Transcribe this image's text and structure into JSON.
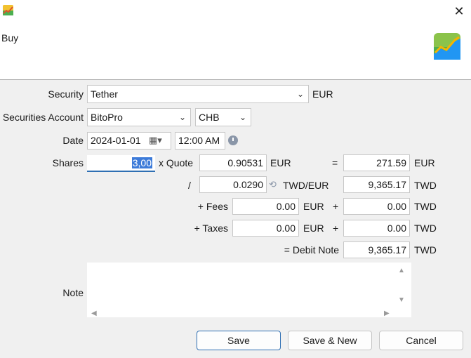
{
  "window": {
    "title": "Buy"
  },
  "form": {
    "security_label": "Security",
    "security_value": "Tether",
    "security_currency": "EUR",
    "account_label": "Securities Account",
    "account_value": "BitoPro",
    "account_currency_value": "CHB",
    "date_label": "Date",
    "date_value": "2024-01-01",
    "time_value": "12:00 AM",
    "shares_label": "Shares",
    "shares_value": "3,00",
    "quote_label": "x Quote",
    "quote_value": "0.90531",
    "quote_currency": "EUR",
    "equals": "=",
    "gross_value": "271.59",
    "gross_currency": "EUR",
    "divide": "/",
    "exchange_rate": "0.0290",
    "exchange_pair": "TWD/EUR",
    "converted_value": "9,365.17",
    "converted_currency": "TWD",
    "fees_label": "+ Fees",
    "fees_value": "0.00",
    "fees_currency": "EUR",
    "plus": "+",
    "fees_converted": "0.00",
    "fees_converted_currency": "TWD",
    "taxes_label": "+ Taxes",
    "taxes_value": "0.00",
    "taxes_currency": "EUR",
    "taxes_converted": "0.00",
    "taxes_converted_currency": "TWD",
    "debit_label": "= Debit Note",
    "debit_value": "9,365.17",
    "debit_currency": "TWD",
    "note_label": "Note"
  },
  "buttons": {
    "save": "Save",
    "save_new": "Save & New",
    "cancel": "Cancel"
  },
  "colors": {
    "selection": "#3d7bd9",
    "default_button_border": "#2f6fb3"
  },
  "icons": {
    "close": "close-icon",
    "calendar": "calendar-icon",
    "clock": "clock-icon",
    "swap": "swap-icon"
  }
}
